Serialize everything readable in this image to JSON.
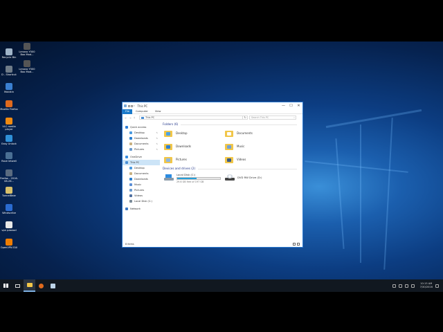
{
  "desktop": {
    "icons": [
      {
        "label": "Recycle Bin",
        "color": "#9fb4c8"
      },
      {
        "label": "D - Shortcut",
        "color": "#6f7c88"
      },
      {
        "label": "Mobikin",
        "color": "#3a7fd0"
      },
      {
        "label": "Mozilla Firefox",
        "color": "#e06a1d"
      },
      {
        "label": "VLC media player",
        "color": "#f08a10"
      },
      {
        "label": "Easy Unlock",
        "color": "#2f90d8"
      },
      {
        "label": "Rave letwell",
        "color": "#4a6f94"
      },
      {
        "label": "Firefox - 2016-08-26...",
        "color": "#5a6b80"
      },
      {
        "label": "TunnelBear",
        "color": "#d8c06a"
      },
      {
        "label": "Windscribe",
        "color": "#2a6bd0"
      },
      {
        "label": "vpn passwd",
        "color": "#e8e8e8"
      },
      {
        "label": "OpenVPN GUI",
        "color": "#ef7d00"
      }
    ],
    "icons_col2": [
      {
        "label": "Lenovo Y500 Boo Mod...",
        "color": "#555"
      },
      {
        "label": "Lenovo Y500 Boo Mod...",
        "color": "#555"
      }
    ]
  },
  "window": {
    "title": "This PC",
    "controls": {
      "minimize": "—",
      "maximize": "☐",
      "close": "✕"
    },
    "ribbon": {
      "file": "File",
      "tabs": [
        "Computer",
        "View"
      ]
    },
    "address": "This PC",
    "search_placeholder": "Search This PC",
    "nav": {
      "quick_access": "Quick access",
      "pinned": [
        {
          "label": "Desktop",
          "color": "#4a9ae0"
        },
        {
          "label": "Downloads",
          "color": "#2a7fd0"
        },
        {
          "label": "Documents",
          "color": "#c8b080"
        },
        {
          "label": "Pictures",
          "color": "#6a9bd0"
        }
      ],
      "onedrive": "OneDrive",
      "this_pc": "This PC",
      "pc_items": [
        {
          "label": "Desktop",
          "color": "#4a9ae0"
        },
        {
          "label": "Documents",
          "color": "#c8b080"
        },
        {
          "label": "Downloads",
          "color": "#2a7fd0"
        },
        {
          "label": "Music",
          "color": "#5a8ed6"
        },
        {
          "label": "Pictures",
          "color": "#6a9bd0"
        },
        {
          "label": "Videos",
          "color": "#5070a0"
        },
        {
          "label": "Local Disk (C:)",
          "color": "#7a8a98"
        }
      ],
      "network": "Network"
    },
    "folders_header": "Folders (6)",
    "folders": [
      {
        "label": "Desktop",
        "color": "#4aa3e6"
      },
      {
        "label": "Documents",
        "color": "#ffffff"
      },
      {
        "label": "Downloads",
        "color": "#2b7fd4"
      },
      {
        "label": "Music",
        "color": "#6fa0d8"
      },
      {
        "label": "Pictures",
        "color": "#8fb7e0"
      },
      {
        "label": "Videos",
        "color": "#3a5c86"
      }
    ],
    "drives_header": "Devices and drives (2)",
    "drives": [
      {
        "label": "Local Disk (C:)",
        "free": "29.6 GB free of 197 GB",
        "used_fraction": 0.45
      },
      {
        "label": "DVD RW Drive (D:)"
      }
    ],
    "status": "8 items"
  },
  "taskbar": {
    "clock_time": "10:15 AM",
    "clock_date": "7/30/2016"
  }
}
